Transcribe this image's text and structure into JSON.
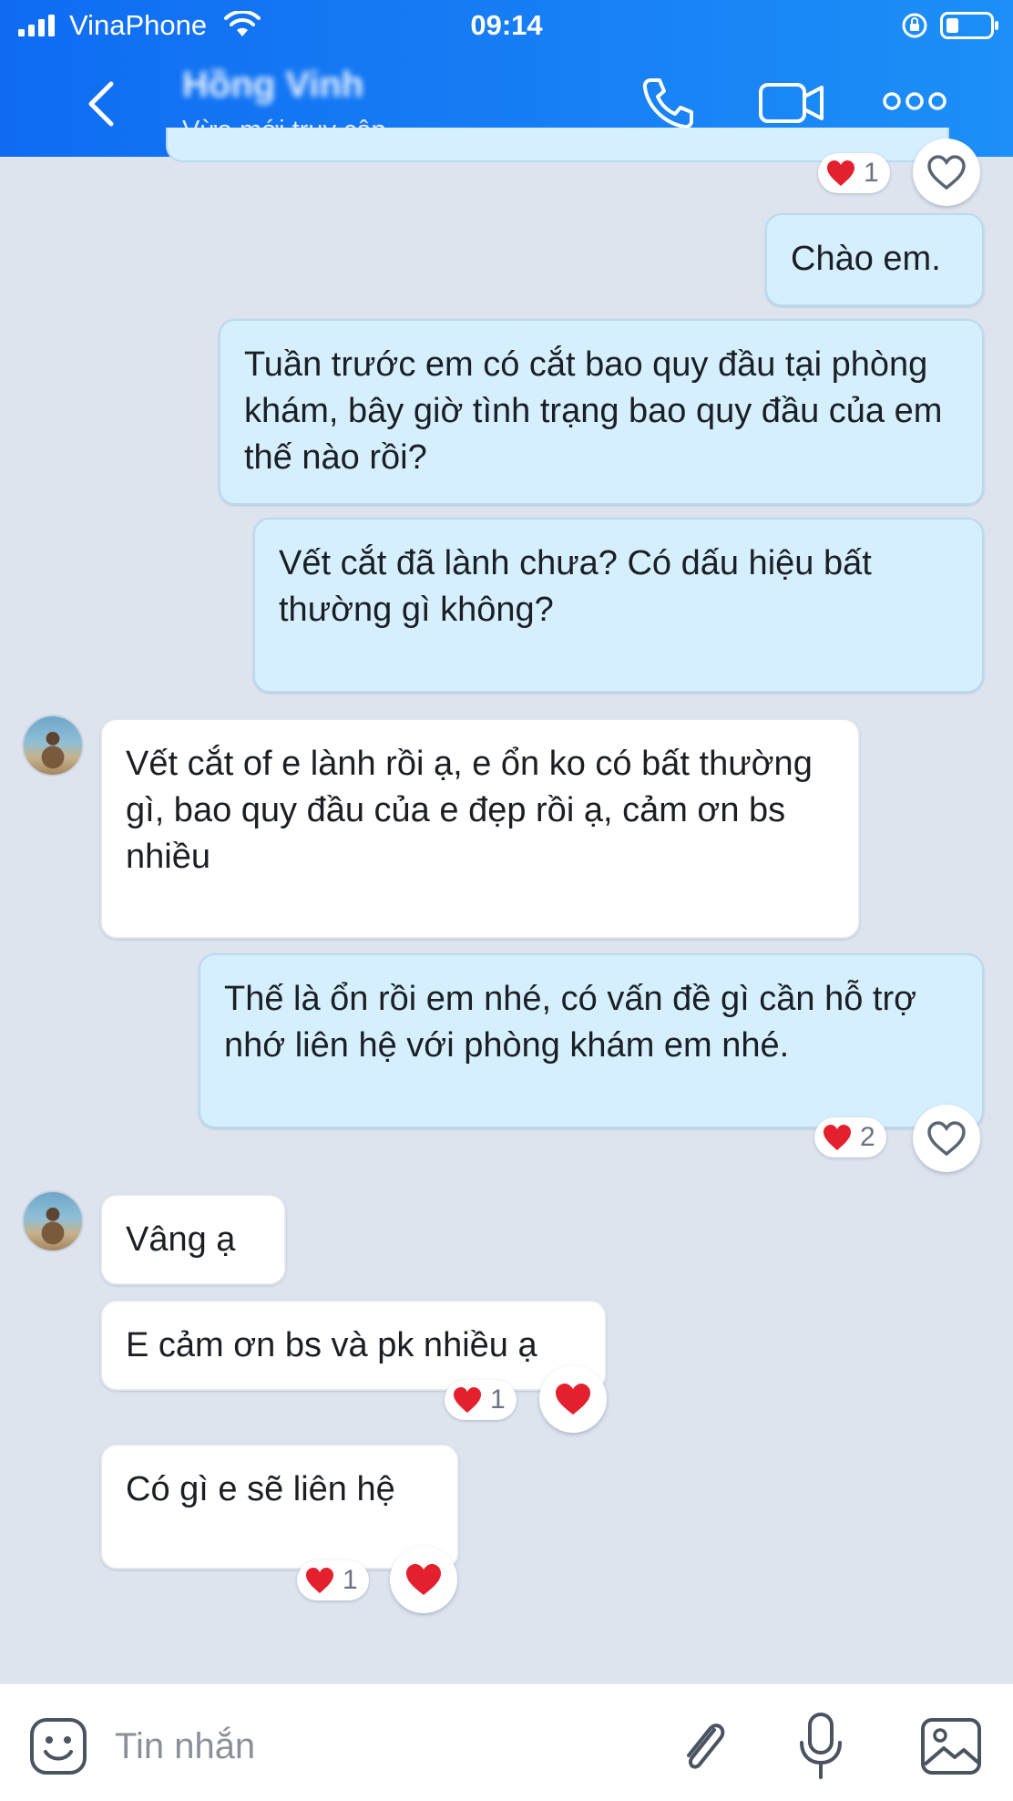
{
  "status_bar": {
    "carrier": "VinaPhone",
    "time": "09:14"
  },
  "header": {
    "contact_name": "Hồng Vinh",
    "contact_status": "Vừa mới truy cập",
    "icons": [
      "back-icon",
      "phone-icon",
      "video-icon",
      "more-icon"
    ]
  },
  "messages": [
    {
      "side": "out",
      "text": "Chào em."
    },
    {
      "side": "out",
      "text": "Tuần trước em có cắt bao quy đầu tại phòng khám, bây giờ tình trạng bao quy đầu của em thế nào rồi?"
    },
    {
      "side": "out",
      "text": "Vết cắt đã lành chưa? Có dấu hiệu bất thường gì không?"
    },
    {
      "side": "in",
      "text": "Vết cắt of e lành rồi ạ,  e ổn ko có bất thường gì,  bao quy đầu của e đẹp rồi ạ, cảm ơn bs nhiều"
    },
    {
      "side": "out",
      "text": "Thế là ổn rồi em nhé, có vấn đề gì cần hỗ trợ nhớ liên hệ với phòng khám em nhé."
    },
    {
      "side": "in",
      "text": "Vâng ạ"
    },
    {
      "side": "in",
      "text": "E cảm ơn bs và pk nhiều ạ"
    },
    {
      "side": "in",
      "text": "Có gì e sẽ liên hệ"
    }
  ],
  "reactions": {
    "prev_count": "1",
    "msg5_count": "2",
    "msg7_count": "1",
    "msg8_count": "1"
  },
  "composer": {
    "placeholder": "Tin nhắn"
  },
  "colors": {
    "header": "#1a82f5",
    "outgoing_bubble": "#d6efff",
    "incoming_bubble": "#ffffff",
    "background": "#dde4ee",
    "heart": "#e5202e"
  }
}
